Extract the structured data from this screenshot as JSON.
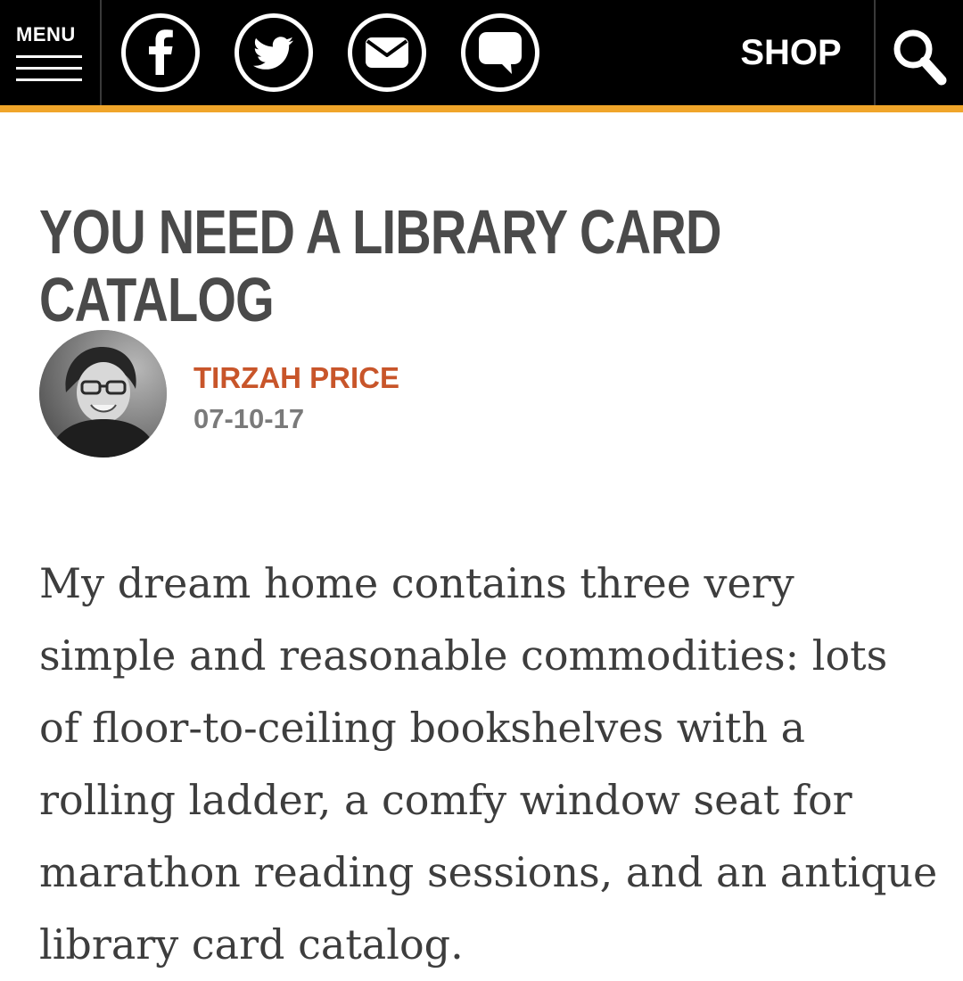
{
  "header": {
    "menu_label": "MENU",
    "social_icons": [
      "facebook-icon",
      "twitter-icon",
      "mail-icon",
      "comment-icon"
    ],
    "shop_label": "SHOP",
    "search_icon": "search-icon",
    "accent_color": "#f0a52a",
    "bar_color": "#000000"
  },
  "article": {
    "title": "YOU NEED A LIBRARY CARD CATALOG",
    "author": "TIRZAH PRICE",
    "author_color": "#c8552a",
    "date": "07-10-17",
    "body": "My dream home contains three very simple and reasonable commodities: lots of floor-to-ceiling bookshelves with a rolling ladder, a comfy window seat for marathon reading sessions, and an antique library card catalog."
  }
}
